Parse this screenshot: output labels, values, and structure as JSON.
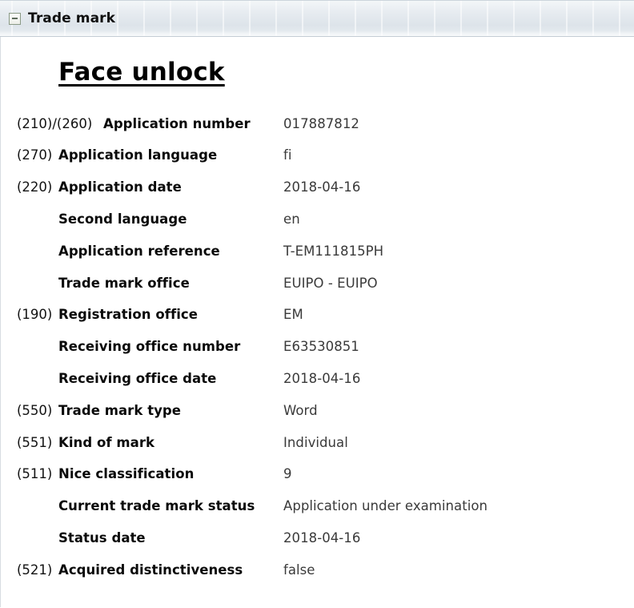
{
  "panel": {
    "header_title": "Trade mark",
    "collapse_icon": "minus-square-icon",
    "collapsed": false
  },
  "mark": {
    "title": "Face unlock"
  },
  "fields": [
    {
      "inid": "(210)/(260)",
      "label": "Application number",
      "value": "017887812",
      "wide": true
    },
    {
      "inid": "(270)",
      "label": "Application language",
      "value": "fi",
      "wide": false
    },
    {
      "inid": "(220)",
      "label": "Application date",
      "value": "2018-04-16",
      "wide": false
    },
    {
      "inid": "",
      "label": "Second language",
      "value": "en",
      "wide": false
    },
    {
      "inid": "",
      "label": "Application reference",
      "value": "T-EM111815PH",
      "wide": false
    },
    {
      "inid": "",
      "label": "Trade mark office",
      "value": "EUIPO - EUIPO",
      "wide": false
    },
    {
      "inid": "(190)",
      "label": "Registration office",
      "value": "EM",
      "wide": false
    },
    {
      "inid": "",
      "label": "Receiving office number",
      "value": "E63530851",
      "wide": false
    },
    {
      "inid": "",
      "label": "Receiving office date",
      "value": "2018-04-16",
      "wide": false
    },
    {
      "inid": "(550)",
      "label": "Trade mark type",
      "value": "Word",
      "wide": false
    },
    {
      "inid": "(551)",
      "label": "Kind of mark",
      "value": "Individual",
      "wide": false
    },
    {
      "inid": "(511)",
      "label": "Nice classification",
      "value": "9",
      "wide": false
    },
    {
      "inid": "",
      "label": "Current trade mark status",
      "value": "Application under examination",
      "wide": false
    },
    {
      "inid": "",
      "label": "Status date",
      "value": "2018-04-16",
      "wide": false
    },
    {
      "inid": "(521)",
      "label": "Acquired distinctiveness",
      "value": "false",
      "wide": false
    }
  ],
  "colors": {
    "header_background": "#dfe5eb",
    "header_border": "#c3ccd4",
    "toggle_border": "#8a9a86",
    "label_text": "#0a0a0a",
    "value_text": "#3a3a3a",
    "body_background": "#ffffff"
  }
}
